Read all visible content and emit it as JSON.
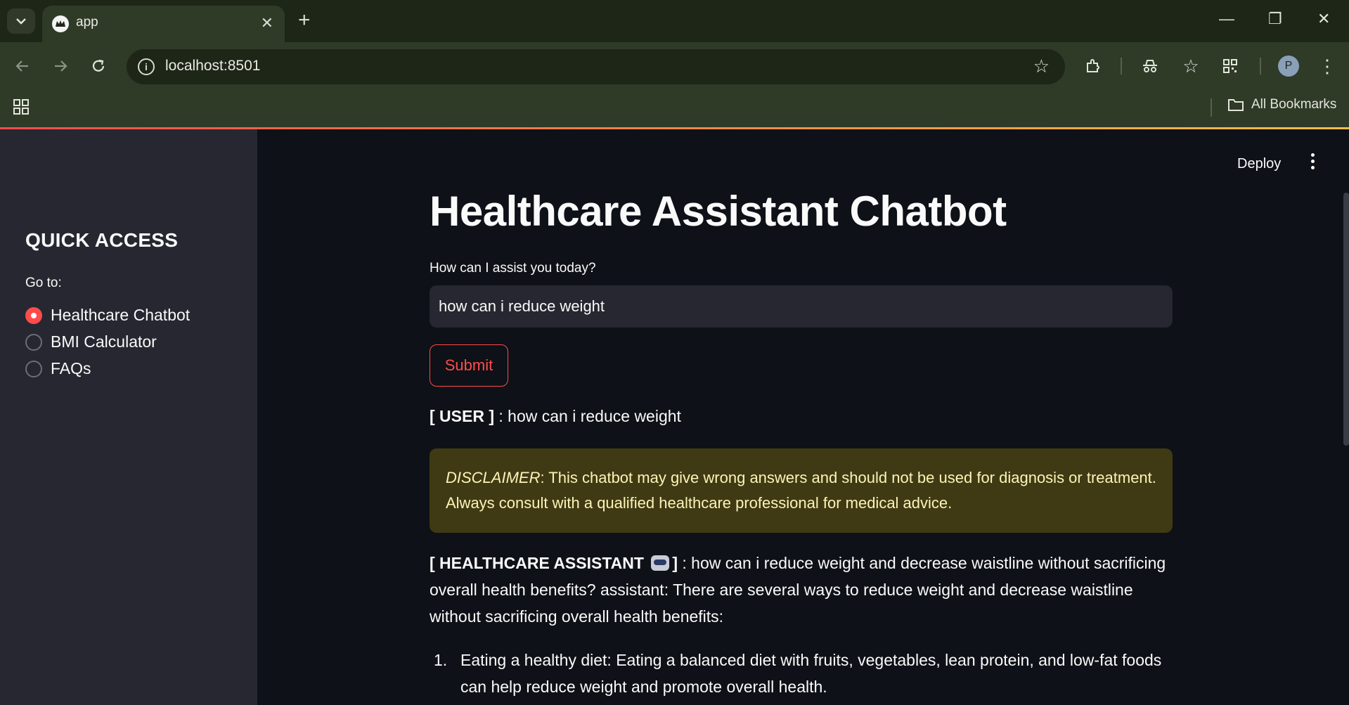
{
  "browser": {
    "tab_title": "app",
    "url": "localhost:8501",
    "bookmarks_label": "All Bookmarks",
    "profile_initial": "P"
  },
  "app": {
    "deploy_label": "Deploy",
    "accent_color": "#ff4b4b"
  },
  "sidebar": {
    "title": "QUICK ACCESS",
    "goto_label": "Go to:",
    "options": [
      {
        "label": "Healthcare Chatbot",
        "selected": true
      },
      {
        "label": "BMI Calculator",
        "selected": false
      },
      {
        "label": "FAQs",
        "selected": false
      }
    ]
  },
  "main": {
    "title": "Healthcare Assistant Chatbot",
    "input_label": "How can I assist you today?",
    "input_value": "how can i reduce weight",
    "submit_label": "Submit",
    "user_tag": "[ USER ]",
    "user_message": " : how can i reduce weight",
    "disclaimer_label": "DISCLAIMER",
    "disclaimer_text": ": This chatbot may give wrong answers and should not be used for diagnosis or treatment. Always consult with a qualified healthcare professional for medical advice.",
    "assistant_tag_start": "[ HEALTHCARE ASSISTANT",
    "assistant_tag_end": "]",
    "assistant_message": " : how can i reduce weight and decrease waistline without sacrificing overall health benefits? assistant: There are several ways to reduce weight and decrease waistline without sacrificing overall health benefits:",
    "list_items": [
      {
        "num": "1.",
        "text": "Eating a healthy diet: Eating a balanced diet with fruits, vegetables, lean protein, and low-fat foods can help reduce weight and promote overall health."
      }
    ]
  }
}
